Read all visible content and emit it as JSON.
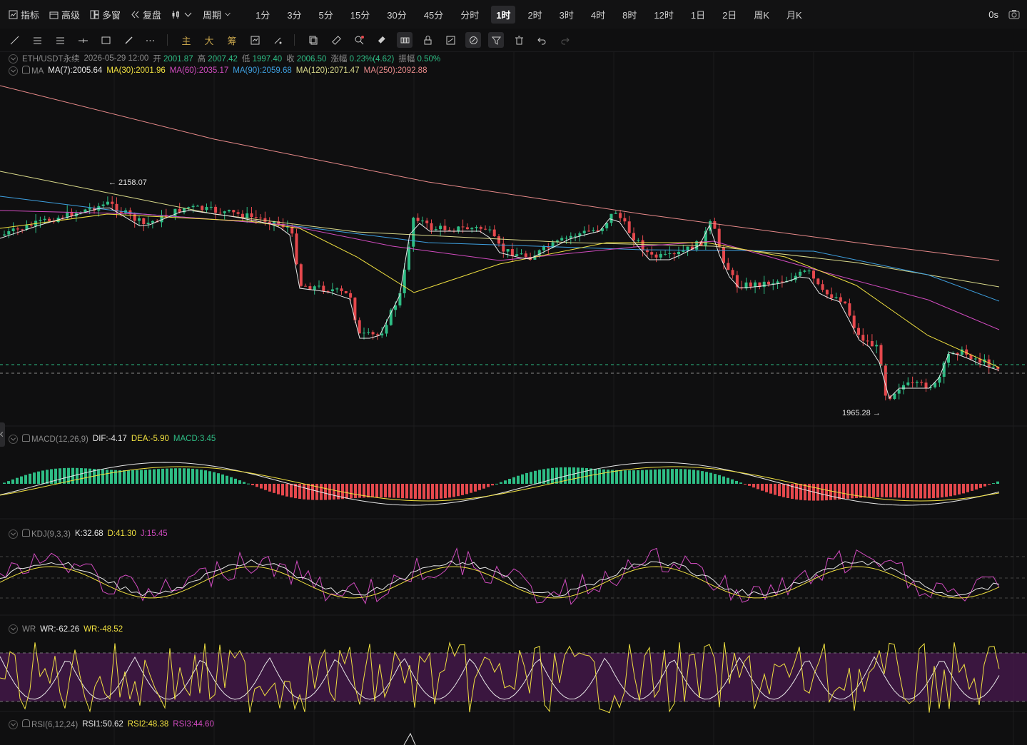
{
  "topbar": {
    "buttons": [
      {
        "label": "指标",
        "icon": "indicator-icon"
      },
      {
        "label": "高级",
        "icon": "advanced-icon"
      },
      {
        "label": "多窗",
        "icon": "multi-window-icon"
      },
      {
        "label": "复盘",
        "icon": "replay-icon"
      }
    ],
    "period_menu": "周期",
    "periods": [
      "1分",
      "3分",
      "5分",
      "15分",
      "30分",
      "45分",
      "分时",
      "1时",
      "2时",
      "3时",
      "4时",
      "8时",
      "12时",
      "1日",
      "2日",
      "周K",
      "月K"
    ],
    "active_period": "1时",
    "countdown": "0s"
  },
  "toolbar": {
    "text_tools": [
      "主",
      "大",
      "筹"
    ]
  },
  "legend": {
    "symbol": "ETH/USDT永续",
    "datetime": "2026-05-29 12:00",
    "open_label": "开",
    "open": "2001.87",
    "high_label": "高",
    "high": "2007.42",
    "low_label": "低",
    "low": "1997.40",
    "close_label": "收",
    "close": "2006.50",
    "change_label": "涨幅",
    "change": "0.23%(4.62)",
    "amp_label": "振幅",
    "amp": "0.50%",
    "ma_name": "MA",
    "ma": [
      {
        "label": "MA(7):2005.64",
        "color": "#e8e8e8"
      },
      {
        "label": "MA(30):2001.96",
        "color": "#f0e040"
      },
      {
        "label": "MA(60):2035.17",
        "color": "#d24bc0"
      },
      {
        "label": "MA(90):2059.68",
        "color": "#3ea0e0"
      },
      {
        "label": "MA(120):2071.47",
        "color": "#d9d98a"
      },
      {
        "label": "MA(250):2092.88",
        "color": "#e88a8a"
      }
    ],
    "max_price": "2158.07",
    "min_price": "1965.28"
  },
  "macd": {
    "name": "MACD(12,26,9)",
    "dif": "DIF:-4.17",
    "dea": "DEA:-5.90",
    "macd": "MACD:3.45"
  },
  "kdj": {
    "name": "KDJ(9,3,3)",
    "k": "K:32.68",
    "d": "D:41.30",
    "j": "J:15.45"
  },
  "wr": {
    "name": "WR",
    "wr1": "WR:-62.26",
    "wr2": "WR:-48.52"
  },
  "rsi": {
    "name": "RSI(6,12,24)",
    "rsi1": "RSI1:50.62",
    "rsi2": "RSI2:48.38",
    "rsi3": "RSI3:44.60"
  },
  "colors": {
    "up": "#2ebd85",
    "down": "#e5484d",
    "bg": "#0f0f10",
    "wr_band": "#4a1a4f"
  }
}
